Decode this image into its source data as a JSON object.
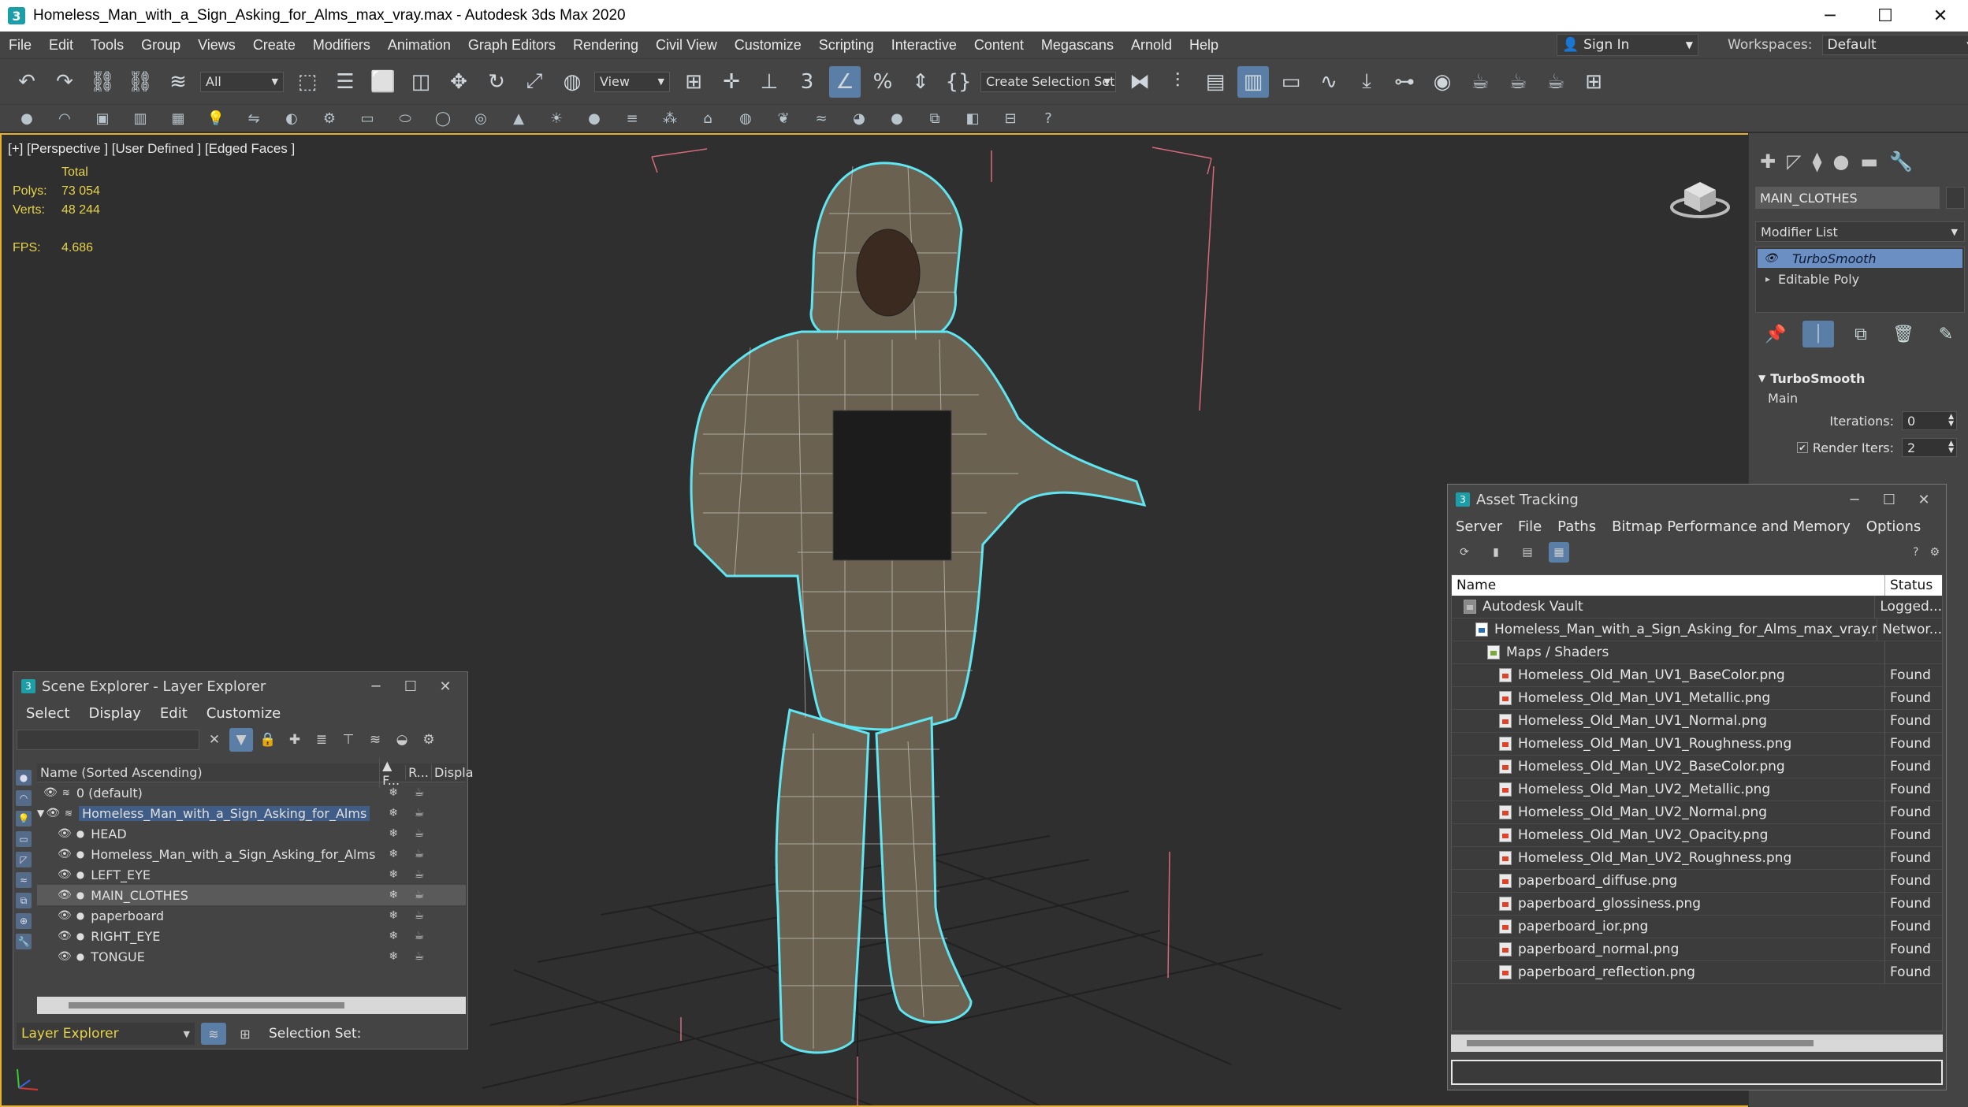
{
  "window": {
    "title": "Homeless_Man_with_a_Sign_Asking_for_Alms_max_vray.max - Autodesk 3ds Max 2020",
    "app_icon_glyph": "3",
    "controls": {
      "minimize": "─",
      "maximize": "☐",
      "close": "✕"
    }
  },
  "menubar": {
    "items": [
      "File",
      "Edit",
      "Tools",
      "Group",
      "Views",
      "Create",
      "Modifiers",
      "Animation",
      "Graph Editors",
      "Rendering",
      "Civil View",
      "Customize",
      "Scripting",
      "Interactive",
      "Content",
      "Megascans",
      "Arnold",
      "Help"
    ],
    "sign_in": "Sign In",
    "workspaces_label": "Workspaces:",
    "workspaces_value": "Default"
  },
  "toolbar": {
    "selection_filter": "All",
    "ref_coord": "View",
    "named_selection": "Create Selection Set"
  },
  "viewport": {
    "label": "[+] [Perspective ] [User Defined ] [Edged Faces ]",
    "stats_header": "Total",
    "polys_label": "Polys:",
    "polys_value": "73 054",
    "verts_label": "Verts:",
    "verts_value": "48 244",
    "fps_label": "FPS:",
    "fps_value": "4.686"
  },
  "command_panel": {
    "object_name": "MAIN_CLOTHES",
    "modifier_list": "Modifier List",
    "stack": [
      {
        "label": "TurboSmooth",
        "selected": true
      },
      {
        "label": "Editable Poly",
        "selected": false
      }
    ],
    "rollout_title": "TurboSmooth",
    "rollout_section": "Main",
    "iterations_label": "Iterations:",
    "iterations_value": "0",
    "render_iters_label": "Render Iters:",
    "render_iters_value": "2"
  },
  "scene_explorer": {
    "title": "Scene Explorer - Layer Explorer",
    "menu": [
      "Select",
      "Display",
      "Edit",
      "Customize"
    ],
    "columns": {
      "name": "Name (Sorted Ascending)",
      "frozen": "▲ F...",
      "render": "R...",
      "display": "Displa"
    },
    "rows": [
      {
        "name": "0 (default)",
        "level": 0,
        "selected": false,
        "highlight": false
      },
      {
        "name": "Homeless_Man_with_a_Sign_Asking_for_Alms",
        "level": 0,
        "selected": false,
        "highlight": true
      },
      {
        "name": "HEAD",
        "level": 1,
        "selected": false,
        "highlight": false
      },
      {
        "name": "Homeless_Man_with_a_Sign_Asking_for_Alms",
        "level": 1,
        "selected": false,
        "highlight": false
      },
      {
        "name": "LEFT_EYE",
        "level": 1,
        "selected": false,
        "highlight": false
      },
      {
        "name": "MAIN_CLOTHES",
        "level": 1,
        "selected": true,
        "highlight": false
      },
      {
        "name": "paperboard",
        "level": 1,
        "selected": false,
        "highlight": false
      },
      {
        "name": "RIGHT_EYE",
        "level": 1,
        "selected": false,
        "highlight": false
      },
      {
        "name": "TONGUE",
        "level": 1,
        "selected": false,
        "highlight": false
      }
    ],
    "explorer_type": "Layer Explorer",
    "selection_set_label": "Selection Set:"
  },
  "asset_tracking": {
    "title": "Asset Tracking",
    "menu": [
      "Server",
      "File",
      "Paths",
      "Bitmap Performance and Memory",
      "Options"
    ],
    "columns": {
      "name": "Name",
      "status": "Status"
    },
    "rows": [
      {
        "name": "Autodesk Vault",
        "status": "Logged...",
        "indent": 1,
        "icon": "vault"
      },
      {
        "name": "Homeless_Man_with_a_Sign_Asking_for_Alms_max_vray.max",
        "status": "Networ...",
        "indent": 2,
        "icon": "max"
      },
      {
        "name": "Maps / Shaders",
        "status": "",
        "indent": 3,
        "icon": "folder"
      },
      {
        "name": "Homeless_Old_Man_UV1_BaseColor.png",
        "status": "Found",
        "indent": 4,
        "icon": "file"
      },
      {
        "name": "Homeless_Old_Man_UV1_Metallic.png",
        "status": "Found",
        "indent": 4,
        "icon": "file"
      },
      {
        "name": "Homeless_Old_Man_UV1_Normal.png",
        "status": "Found",
        "indent": 4,
        "icon": "file"
      },
      {
        "name": "Homeless_Old_Man_UV1_Roughness.png",
        "status": "Found",
        "indent": 4,
        "icon": "file"
      },
      {
        "name": "Homeless_Old_Man_UV2_BaseColor.png",
        "status": "Found",
        "indent": 4,
        "icon": "file"
      },
      {
        "name": "Homeless_Old_Man_UV2_Metallic.png",
        "status": "Found",
        "indent": 4,
        "icon": "file"
      },
      {
        "name": "Homeless_Old_Man_UV2_Normal.png",
        "status": "Found",
        "indent": 4,
        "icon": "file"
      },
      {
        "name": "Homeless_Old_Man_UV2_Opacity.png",
        "status": "Found",
        "indent": 4,
        "icon": "file"
      },
      {
        "name": "Homeless_Old_Man_UV2_Roughness.png",
        "status": "Found",
        "indent": 4,
        "icon": "file"
      },
      {
        "name": "paperboard_diffuse.png",
        "status": "Found",
        "indent": 4,
        "icon": "file"
      },
      {
        "name": "paperboard_glossiness.png",
        "status": "Found",
        "indent": 4,
        "icon": "file"
      },
      {
        "name": "paperboard_ior.png",
        "status": "Found",
        "indent": 4,
        "icon": "file"
      },
      {
        "name": "paperboard_normal.png",
        "status": "Found",
        "indent": 4,
        "icon": "file"
      },
      {
        "name": "paperboard_reflection.png",
        "status": "Found",
        "indent": 4,
        "icon": "file"
      }
    ]
  },
  "colors": {
    "selection_accent": "#5b7ea6",
    "viewport_border": "#e9b12a",
    "stats_text": "#e6d34a",
    "wireframe": "#e8e8e8",
    "selection_outline": "#5fe6f2"
  }
}
